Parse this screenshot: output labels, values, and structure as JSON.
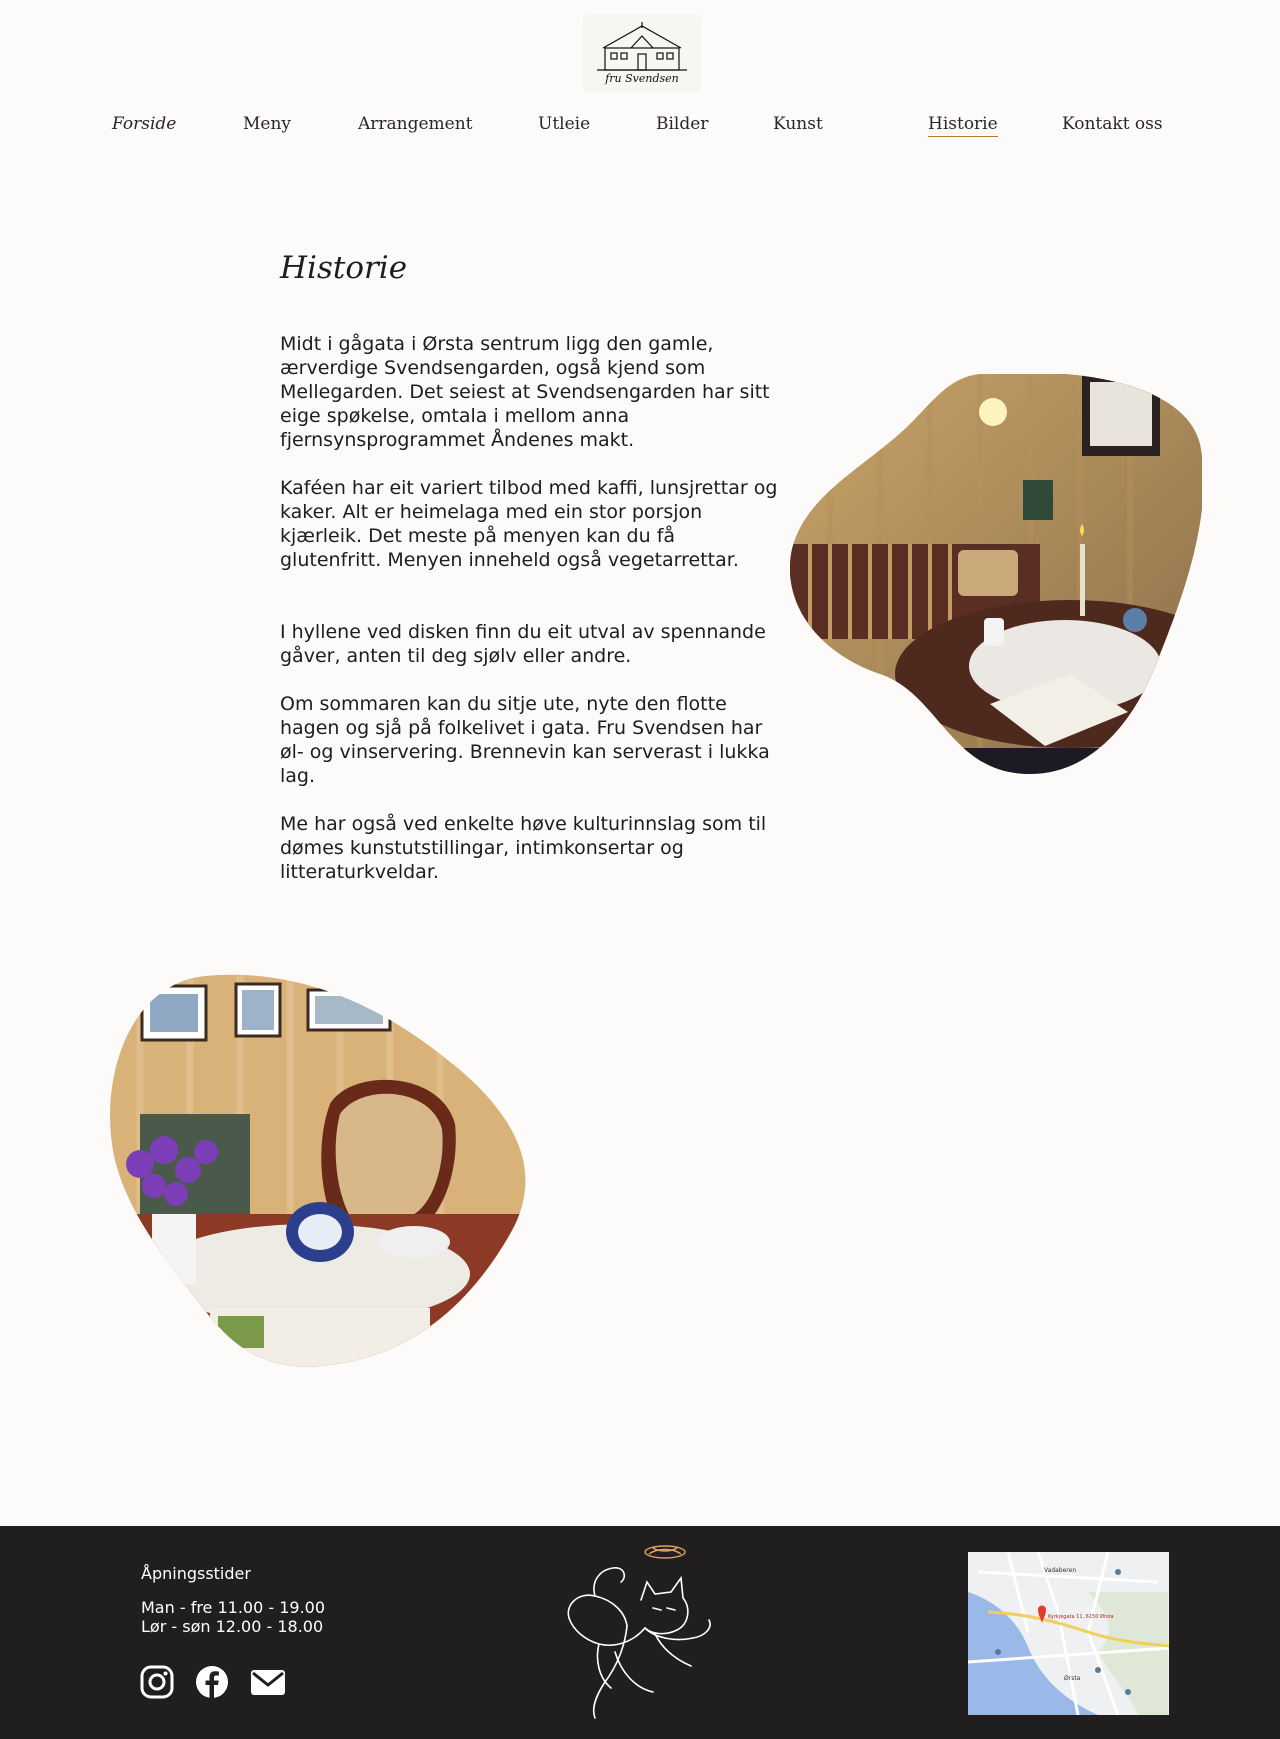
{
  "header": {
    "logo_text": "fru Svendsen",
    "nav": [
      {
        "label": "Forside"
      },
      {
        "label": "Meny"
      },
      {
        "label": "Arrangement"
      },
      {
        "label": "Utleie"
      },
      {
        "label": "Bilder"
      },
      {
        "label": "Kunst"
      },
      {
        "label": "Historie",
        "active": true
      },
      {
        "label": "Kontakt oss"
      }
    ]
  },
  "main": {
    "title": "Historie",
    "paragraphs": [
      "Midt i gågata i Ørsta sentrum ligg den gamle, ærverdige Svendsengarden, også kjend som Mellegarden. Det seiest at Svendsengarden har sitt eige spøkelse, omtala i mellom anna fjernsynsprogrammet Åndenes makt.",
      "Kaféen har eit variert tilbod med kaffi, lunsjrettar og kaker. Alt er heimelaga med ein stor porsjon kjærleik. Det meste på menyen kan du få  glutenfritt. Menyen inneheld også vegetarrettar.",
      "I hyllene ved disken finn du eit utval av spennande gåver, anten til deg sjølv eller andre.",
      "Om sommaren kan du sitje ute, nyte den flotte hagen og sjå på folkelivet i gata. Fru Svendsen har øl- og vinservering. Brennevin kan serverast i lukka lag.",
      "Me har også ved enkelte høve kulturinnslag som til dømes kunstutstillingar, intimkonsertar og litteraturkveldar."
    ]
  },
  "footer": {
    "hours_title": "Åpningsstider",
    "hours": [
      "Man - fre 11.00 - 19.00",
      "Lør - søn 12.00 - 18.00"
    ],
    "social_icons": [
      "instagram-icon",
      "facebook-icon",
      "mail-icon"
    ],
    "map_labels": {
      "district": "Vadaberen",
      "address": "Kyrkjegata 11, 6150 Ørsta",
      "town": "Ørsta"
    }
  },
  "colors": {
    "background": "#fcfbf9",
    "footer": "#211e1f",
    "accent": "#b87a2e"
  }
}
